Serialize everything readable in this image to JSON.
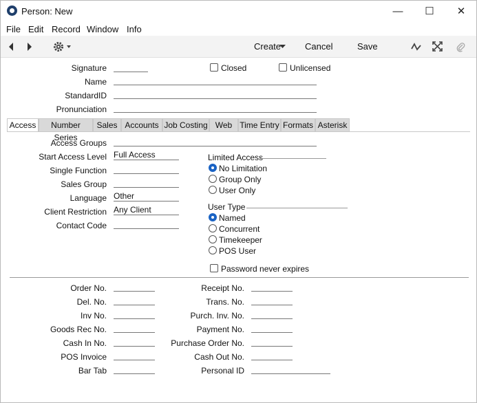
{
  "window": {
    "title": "Person: New",
    "minimize": "—",
    "maximize": "☐",
    "close": "✕"
  },
  "menu": [
    "File",
    "Edit",
    "Record",
    "Window",
    "Info"
  ],
  "toolbar": {
    "create_label": "Create",
    "cancel_label": "Cancel",
    "save_label": "Save"
  },
  "header": {
    "signature_label": "Signature",
    "signature_value": "",
    "closed_label": "Closed",
    "unlicensed_label": "Unlicensed",
    "name_label": "Name",
    "name_value": "",
    "standardid_label": "StandardID",
    "standardid_value": "",
    "pronunciation_label": "Pronunciation",
    "pronunciation_value": ""
  },
  "tabs": [
    "Access",
    "Number Series",
    "Sales",
    "Accounts",
    "Job Costing",
    "Web",
    "Time Entry",
    "Formats",
    "Asterisk"
  ],
  "access": {
    "access_groups_label": "Access Groups",
    "access_groups_value": "",
    "start_access_level_label": "Start Access Level",
    "start_access_level_value": "Full Access",
    "single_function_label": "Single Function",
    "single_function_value": "",
    "sales_group_label": "Sales Group",
    "sales_group_value": "",
    "language_label": "Language",
    "language_value": "Other",
    "client_restriction_label": "Client Restriction",
    "client_restriction_value": "Any Client",
    "contact_code_label": "Contact Code",
    "contact_code_value": "",
    "limited_access_title": "Limited Access",
    "limited_access_options": [
      "No Limitation",
      "Group Only",
      "User Only"
    ],
    "limited_access_selected": "No Limitation",
    "user_type_title": "User Type",
    "user_type_options": [
      "Named",
      "Concurrent",
      "Timekeeper",
      "POS User"
    ],
    "user_type_selected": "Named",
    "password_never_expires_label": "Password never expires"
  },
  "numbers_left": [
    {
      "label": "Order No.",
      "value": ""
    },
    {
      "label": "Del. No.",
      "value": ""
    },
    {
      "label": "Inv No.",
      "value": ""
    },
    {
      "label": "Goods Rec No.",
      "value": ""
    },
    {
      "label": "Cash In No.",
      "value": ""
    },
    {
      "label": "POS Invoice",
      "value": ""
    },
    {
      "label": "Bar Tab",
      "value": ""
    }
  ],
  "numbers_right": [
    {
      "label": "Receipt No.",
      "value": ""
    },
    {
      "label": "Trans. No.",
      "value": ""
    },
    {
      "label": "Purch. Inv. No.",
      "value": ""
    },
    {
      "label": "Payment No.",
      "value": ""
    },
    {
      "label": "Purchase Order No.",
      "value": ""
    },
    {
      "label": "Cash Out No.",
      "value": ""
    },
    {
      "label": "Personal ID",
      "value": ""
    }
  ],
  "colors": {
    "accent": "#1a63c4",
    "tab_inactive": "#d9d9d9",
    "toolbar_bg": "#f3f3f3"
  }
}
